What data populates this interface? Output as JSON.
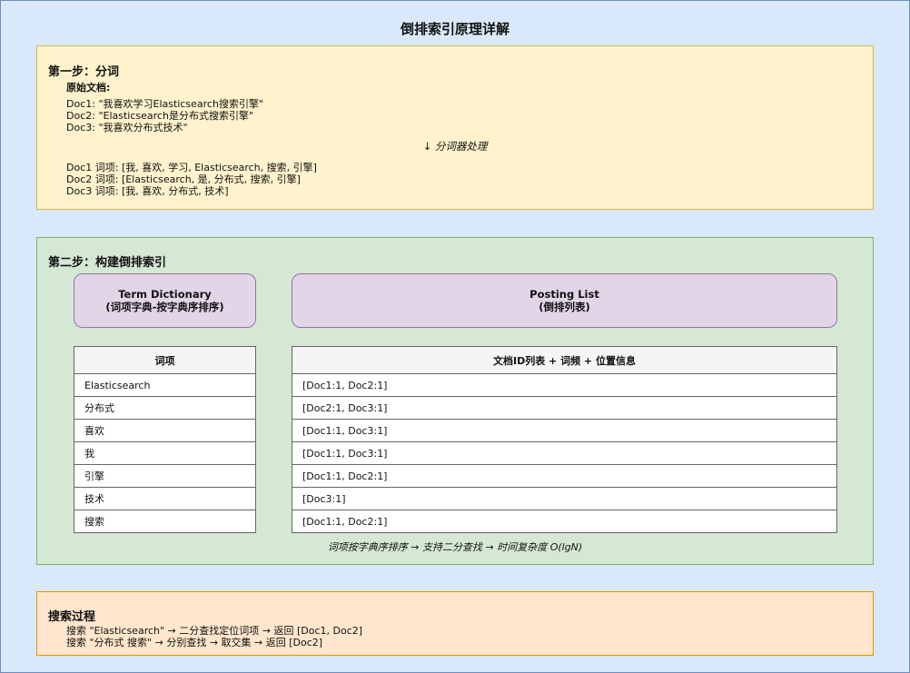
{
  "title": "倒排索引原理详解",
  "step1": {
    "heading": "第一步：分词",
    "docs_label": "原始文档:",
    "docs": [
      "Doc1: \"我喜欢学习Elasticsearch搜索引擎\"",
      "Doc2: \"Elasticsearch是分布式搜索引擎\"",
      "Doc3: \"我喜欢分布式技术\""
    ],
    "process": "↓ 分词器处理",
    "terms": [
      "Doc1 词项: [我, 喜欢, 学习, Elasticsearch, 搜索, 引擎]",
      "Doc2 词项: [Elasticsearch, 是, 分布式, 搜索, 引擎]",
      "Doc3 词项: [我, 喜欢, 分布式, 技术]"
    ]
  },
  "step2": {
    "heading": "第二步：构建倒排索引",
    "dict_box": {
      "line1": "Term Dictionary",
      "line2": "(词项字典-按字典序排序)"
    },
    "posting_box": {
      "line1": "Posting List",
      "line2": "(倒排列表)"
    },
    "term_header": "词项",
    "posting_header": "文档ID列表 + 词频 + 位置信息",
    "rows": [
      {
        "term": "Elasticsearch",
        "posting": "[Doc1:1, Doc2:1]"
      },
      {
        "term": "分布式",
        "posting": "[Doc2:1, Doc3:1]"
      },
      {
        "term": "喜欢",
        "posting": "[Doc1:1, Doc3:1]"
      },
      {
        "term": "我",
        "posting": "[Doc1:1, Doc3:1]"
      },
      {
        "term": "引擎",
        "posting": "[Doc1:1, Doc2:1]"
      },
      {
        "term": "技术",
        "posting": "[Doc3:1]"
      },
      {
        "term": "搜索",
        "posting": "[Doc1:1, Doc2:1]"
      }
    ],
    "note": "词项按字典序排序 → 支持二分查找 → 时间复杂度 O(lgN)"
  },
  "search": {
    "heading": "搜索过程",
    "lines": [
      "搜索 \"Elasticsearch\" → 二分查找定位词项 → 返回 [Doc1, Doc2]",
      "搜索 \"分布式 搜索\" → 分别查找 → 取交集 → 返回 [Doc2]"
    ]
  }
}
